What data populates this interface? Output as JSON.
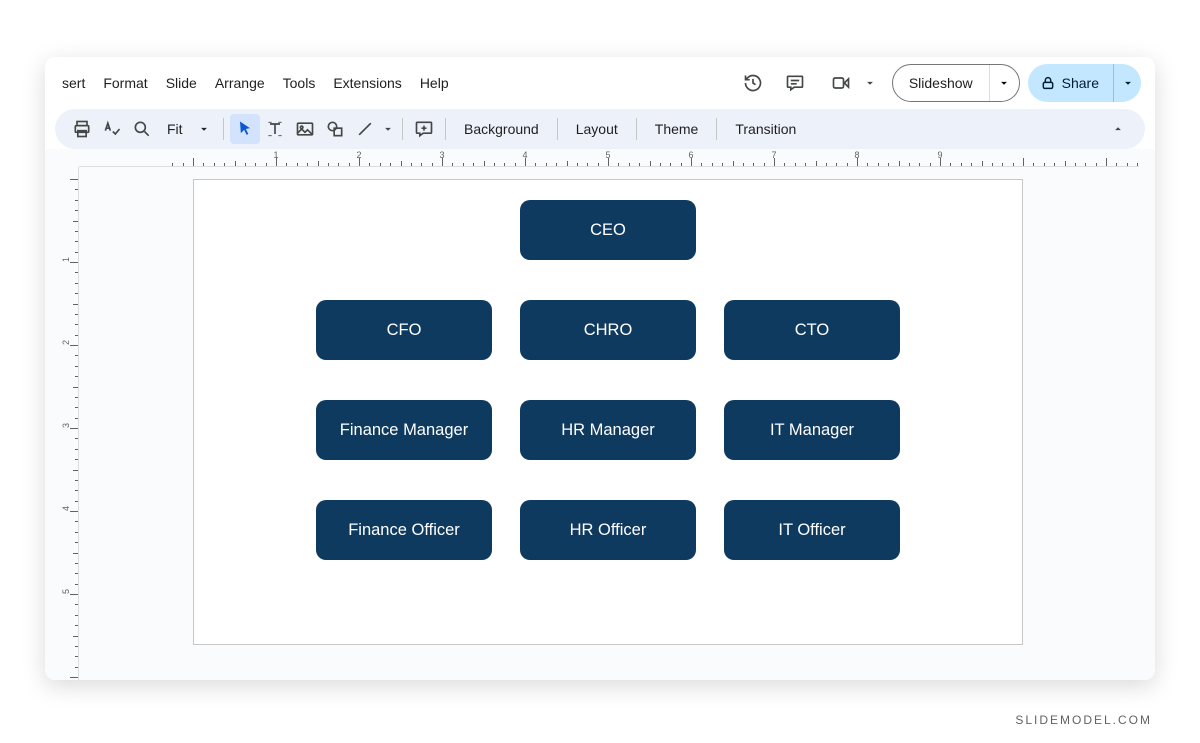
{
  "menus": {
    "items": [
      "sert",
      "Format",
      "Slide",
      "Arrange",
      "Tools",
      "Extensions",
      "Help"
    ]
  },
  "actions": {
    "slideshow_label": "Slideshow",
    "share_label": "Share"
  },
  "toolbar": {
    "zoom_label": "Fit",
    "background_label": "Background",
    "layout_label": "Layout",
    "theme_label": "Theme",
    "transition_label": "Transition"
  },
  "ruler": {
    "h_labels": [
      "1",
      "2",
      "3",
      "4",
      "5",
      "6",
      "7",
      "8",
      "9"
    ],
    "v_labels": [
      "1",
      "2",
      "3",
      "4",
      "5"
    ]
  },
  "org": {
    "ceo": "CEO",
    "row2": [
      "CFO",
      "CHRO",
      "CTO"
    ],
    "row3": [
      "Finance Manager",
      "HR Manager",
      "IT Manager"
    ],
    "row4": [
      "Finance Officer",
      "HR Officer",
      "IT Officer"
    ]
  },
  "watermark": "SLIDEMODEL.COM",
  "chart_data": {
    "type": "table",
    "title": "Organization Chart",
    "hierarchy": {
      "name": "CEO",
      "children": [
        {
          "name": "CFO",
          "children": [
            {
              "name": "Finance Manager",
              "children": [
                {
                  "name": "Finance Officer"
                }
              ]
            }
          ]
        },
        {
          "name": "CHRO",
          "children": [
            {
              "name": "HR Manager",
              "children": [
                {
                  "name": "HR Officer"
                }
              ]
            }
          ]
        },
        {
          "name": "CTO",
          "children": [
            {
              "name": "IT Manager",
              "children": [
                {
                  "name": "IT Officer"
                }
              ]
            }
          ]
        }
      ]
    }
  }
}
